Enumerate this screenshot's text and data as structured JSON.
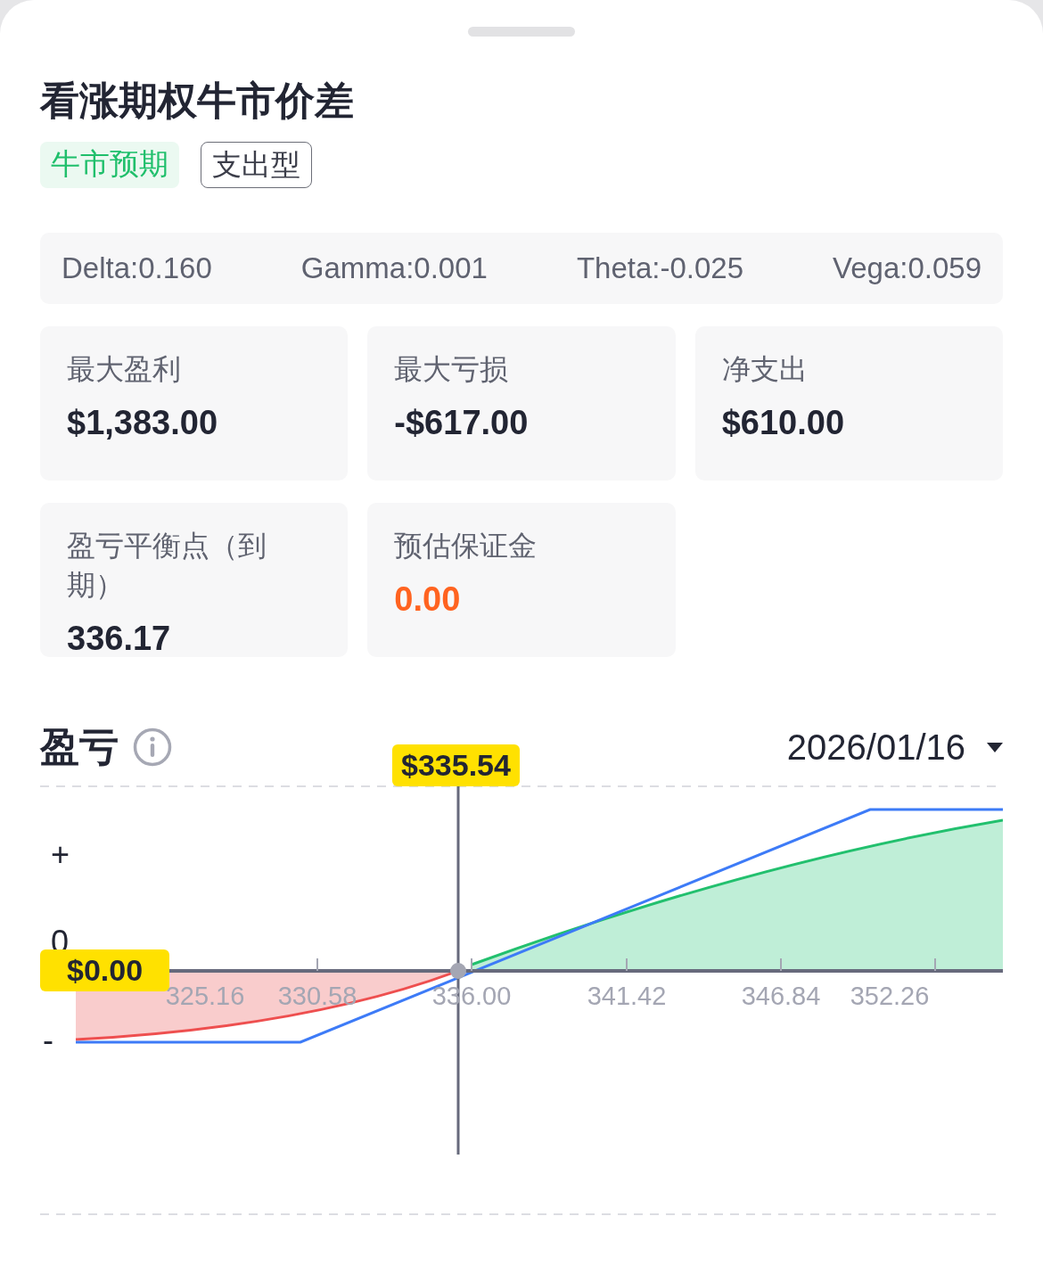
{
  "title": "看涨期权牛市价差",
  "tags": [
    {
      "label": "牛市预期",
      "kind": "filled"
    },
    {
      "label": "支出型",
      "kind": "outline"
    }
  ],
  "greeks": [
    "Delta:0.160",
    "Gamma:0.001",
    "Theta:-0.025",
    "Vega:0.059"
  ],
  "stats": [
    {
      "label": "最大盈利",
      "value": "$1,383.00",
      "color": "#222533"
    },
    {
      "label": "最大亏损",
      "value": "-$617.00",
      "color": "#222533"
    },
    {
      "label": "净支出",
      "value": "$610.00",
      "color": "#222533"
    },
    {
      "label": "盈亏平衡点（到期）",
      "value": "336.17",
      "color": "#222533"
    },
    {
      "label": "预估保证金",
      "value": "0.00",
      "color": "#ff6320"
    }
  ],
  "pnl": {
    "heading": "盈亏",
    "date": "2026/01/16",
    "chart": {
      "y_labels": [
        "+",
        "0",
        "-"
      ],
      "x_labels": [
        "325.16",
        "330.58",
        "336.00",
        "341.42",
        "346.84",
        "352.26"
      ],
      "price_marker": "$335.54",
      "pnl_marker": "$0.00"
    }
  }
}
